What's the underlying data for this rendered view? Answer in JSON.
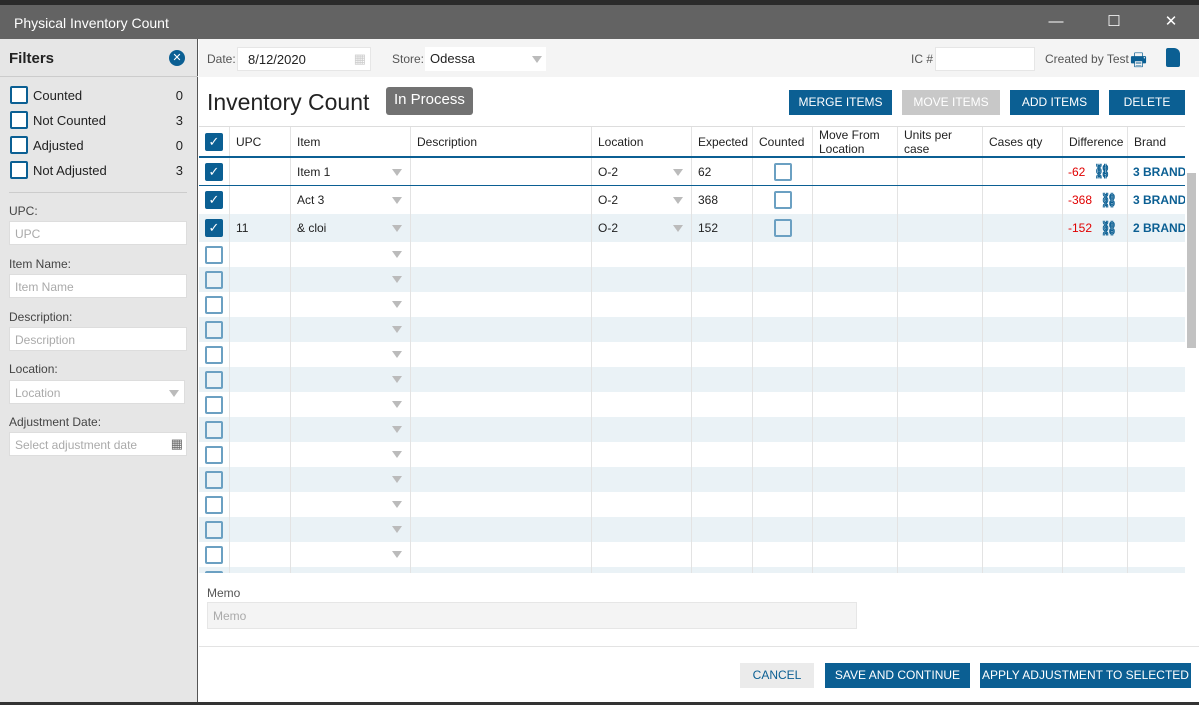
{
  "window": {
    "title": "Physical Inventory Count",
    "minimize": "—",
    "maximize": "☐",
    "close": "✕"
  },
  "filters": {
    "title": "Filters",
    "clear_icon": "close-circle-icon",
    "checks": [
      {
        "label": "Counted",
        "count": "0"
      },
      {
        "label": "Not Counted",
        "count": "3"
      },
      {
        "label": "Adjusted",
        "count": "0"
      },
      {
        "label": "Not Adjusted",
        "count": "3"
      }
    ],
    "upc_label": "UPC:",
    "upc_placeholder": "UPC",
    "item_label": "Item Name:",
    "item_placeholder": "Item Name",
    "desc_label": "Description:",
    "desc_placeholder": "Description",
    "loc_label": "Location:",
    "loc_placeholder": "Location",
    "adj_label": "Adjustment Date:",
    "adj_placeholder": "Select adjustment date"
  },
  "toolbar": {
    "date_label": "Date:",
    "date": "8/12/2020",
    "store_label": "Store:",
    "store": "Odessa",
    "ic_label": "IC #",
    "ic_value": "",
    "created_by": "Created by Test"
  },
  "header": {
    "title": "Inventory Count",
    "status": "In Process",
    "merge": "MERGE ITEMS",
    "move": "MOVE ITEMS",
    "add": "ADD ITEMS",
    "delete": "DELETE"
  },
  "grid": {
    "columns": [
      "UPC",
      "Item",
      "Description",
      "Location",
      "Expected",
      "Counted",
      "Move From Location",
      "Units per case",
      "Cases qty",
      "Difference",
      "Brand"
    ],
    "rows": [
      {
        "checked": true,
        "upc": "",
        "item": "Item 1",
        "description": "",
        "location": "O-2",
        "expected": "62",
        "counted": false,
        "difference": "-62",
        "brand": "3 BRAND"
      },
      {
        "checked": true,
        "upc": "",
        "item": "Act 3",
        "description": "",
        "location": "O-2",
        "expected": "368",
        "counted": false,
        "difference": "-368",
        "brand": "3 BRAND"
      },
      {
        "checked": true,
        "upc": "11",
        "item": "&  cloi",
        "description": "",
        "location": "O-2",
        "expected": "152",
        "counted": false,
        "difference": "-152",
        "brand": "2 BRAND"
      }
    ]
  },
  "memo": {
    "label": "Memo",
    "placeholder": "Memo"
  },
  "footer": {
    "cancel": "CANCEL",
    "save": "SAVE AND CONTINUE",
    "apply": "APPLY ADJUSTMENT TO SELECTED"
  },
  "colors": {
    "accent": "#0b5f93",
    "negative": "#e00000",
    "titlebar": "#636363"
  }
}
